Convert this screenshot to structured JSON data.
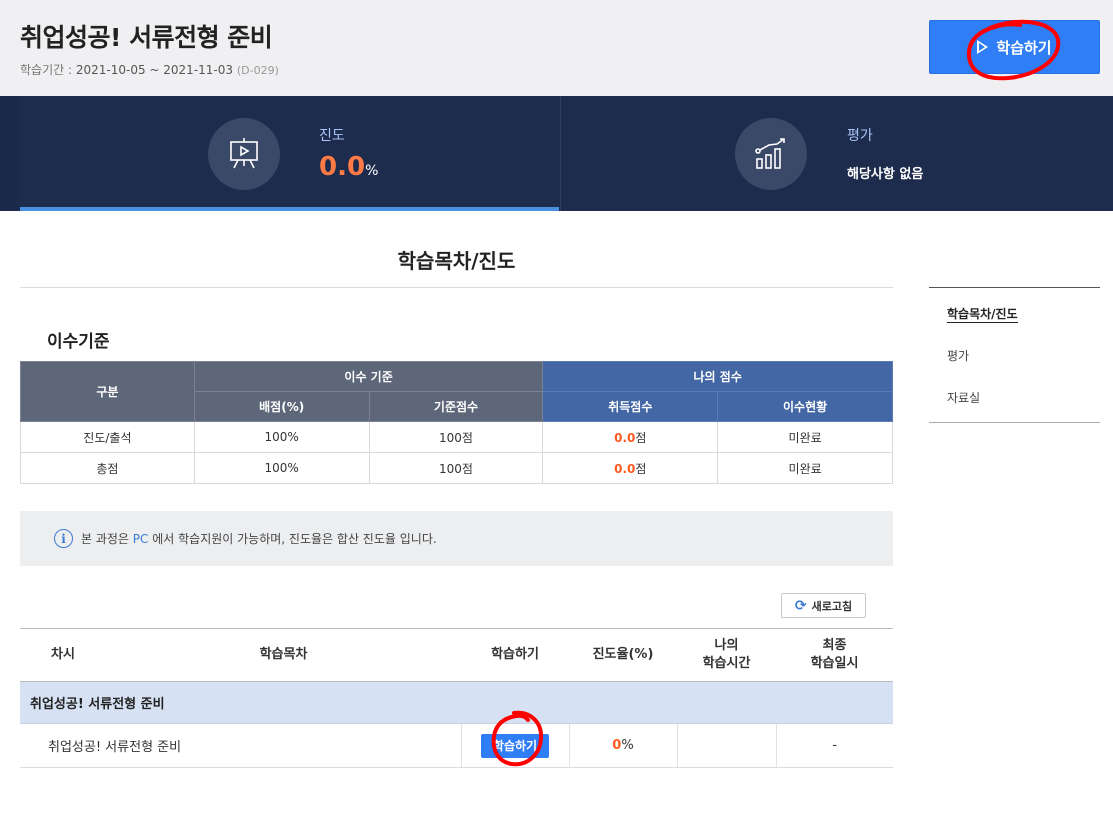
{
  "header": {
    "title": "취업성공! 서류전형 준비",
    "period_label": "학습기간 : ",
    "period_dates": "2021-10-05 ~ 2021-11-03",
    "dday": "(D-029)",
    "study_button": "학습하기"
  },
  "stats": {
    "progress_label": "진도",
    "progress_value": "0.0",
    "progress_unit": "%",
    "eval_label": "평가",
    "eval_value": "해당사항 없음",
    "progress_icon": "presentation-play-icon",
    "eval_icon": "bar-chart-trend-icon"
  },
  "main": {
    "section_title": "학습목차/진도",
    "criteria_title": "이수기준"
  },
  "criteria_table": {
    "h_category": "구분",
    "h_criteria": "이수 기준",
    "h_my_score": "나의 점수",
    "h_weight": "배점(%)",
    "h_base": "기준점수",
    "h_acquired": "취득점수",
    "h_status": "이수현황",
    "rows": [
      {
        "category": "진도/출석",
        "weight": "100%",
        "base": "100점",
        "acquired": "0.0",
        "acquired_unit": "점",
        "status": "미완료"
      },
      {
        "category": "총점",
        "weight": "100%",
        "base": "100점",
        "acquired": "0.0",
        "acquired_unit": "점",
        "status": "미완료"
      }
    ]
  },
  "notice": {
    "prefix": "본 과정은 ",
    "highlight": "PC",
    "suffix": " 에서 학습지원이 가능하며, 진도율은 합산 진도율 입니다."
  },
  "refresh_label": "새로고침",
  "toc": {
    "h_session": "차시",
    "h_contents": "학습목차",
    "h_study": "학습하기",
    "h_rate": "진도율(%)",
    "h_mytime_1": "나의",
    "h_mytime_2": "학습시간",
    "h_last_1": "최종",
    "h_last_2": "학습일시",
    "group": "취업성공! 서류전형 준비",
    "items": [
      {
        "name": "취업성공! 서류전형 준비",
        "study_label": "학습하기",
        "rate": "0",
        "rate_unit": "%",
        "my_time": "",
        "last": "-"
      }
    ]
  },
  "side_nav": {
    "items": [
      "학습목차/진도",
      "평가",
      "자료실"
    ]
  },
  "colors": {
    "accent_blue": "#2f7ef5",
    "navy": "#1b2a4a",
    "orange": "#ff7a45",
    "annotation_red": "#ff0000"
  }
}
